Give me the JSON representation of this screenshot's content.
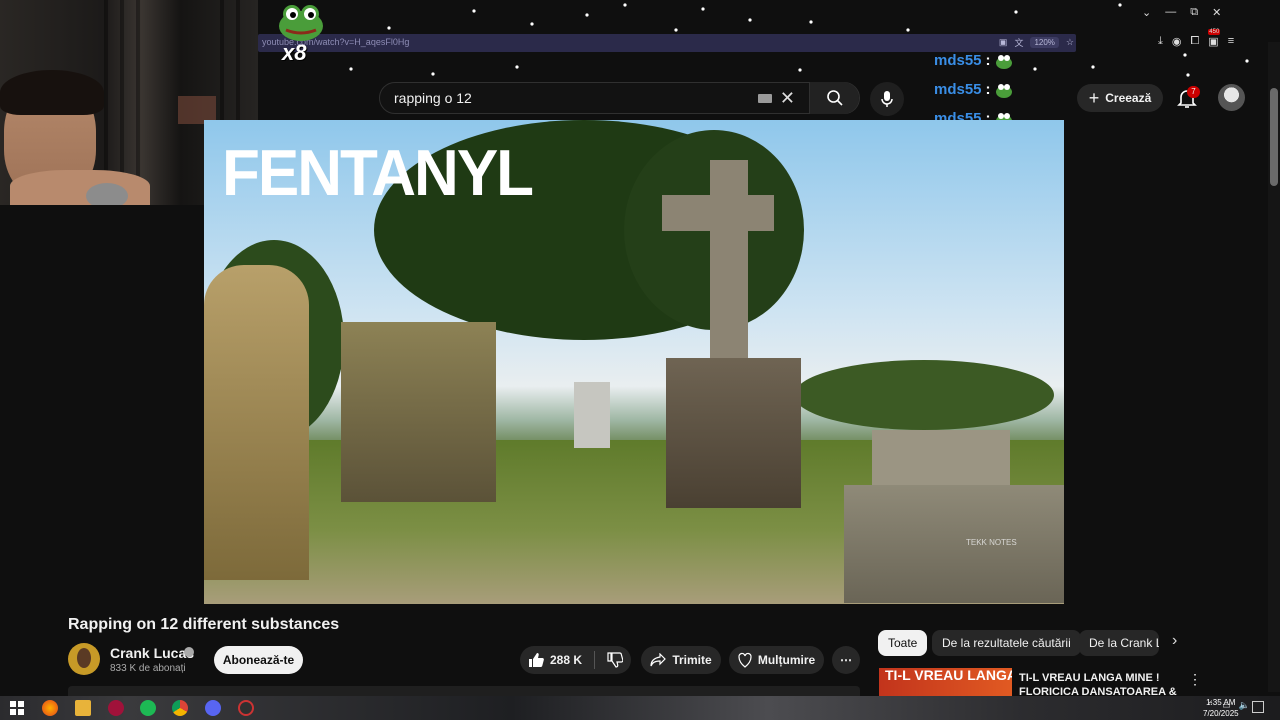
{
  "browser": {
    "url": "youtube.com/watch?v=H_aqesFl0Hg",
    "zoom": "120%",
    "extension_badge": "450"
  },
  "overlay": {
    "emote_count": "x8",
    "chat": [
      {
        "user": "mds55",
        "sep": ":"
      },
      {
        "user": "mds55",
        "sep": ":"
      },
      {
        "user": "mds55",
        "sep": ":"
      }
    ]
  },
  "header": {
    "search_value": "rapping o 12",
    "create_label": "Creează",
    "notifications_count": "7"
  },
  "video": {
    "overlay_text": "FENTANYL",
    "watermark": "TEKK NOTES"
  },
  "info": {
    "title": "Rapping on 12 different substances",
    "channel": "Crank Lucas",
    "subscribers": "833 K de abonați",
    "subscribe_label": "Abonează-te",
    "likes": "288 K",
    "share_label": "Trimite",
    "thanks_label": "Mulțumire"
  },
  "chips": [
    "Toate",
    "De la rezultatele căutării",
    "De la Crank Lu"
  ],
  "recommendation": {
    "thumb_text": "TI-L VREAU LANGA MINE",
    "title": "TI-L VREAU LANGA MINE ! FLORICICA DANSATOAREA &"
  },
  "taskbar": {
    "time": "1:35 AM",
    "date": "7/20/2025"
  }
}
